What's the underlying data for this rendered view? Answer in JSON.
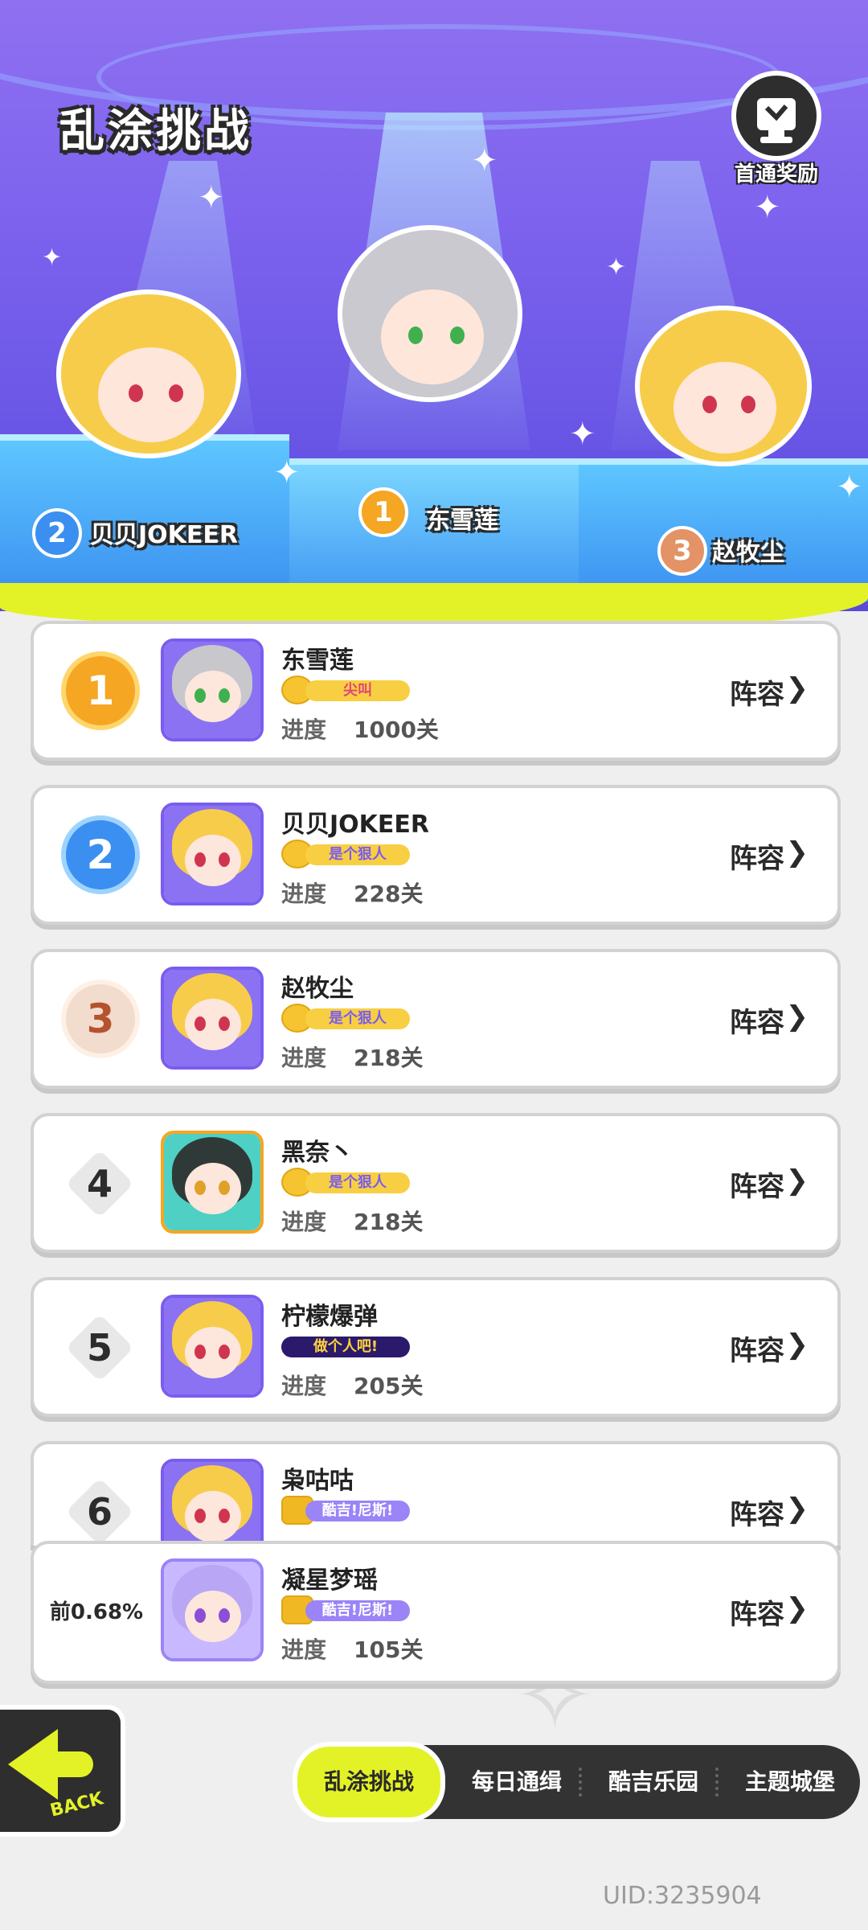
{
  "header": {
    "title": "乱涂挑战",
    "reward_button": {
      "label": "首通奖励",
      "icon": "trophy-icon"
    }
  },
  "podium": [
    {
      "rank": "2",
      "name": "贝贝JOKEER"
    },
    {
      "rank": "1",
      "name": "东雪莲"
    },
    {
      "rank": "3",
      "name": "赵牧尘"
    }
  ],
  "ranking": [
    {
      "rank": "1",
      "name": "东雪莲",
      "badge": "尖叫",
      "progress_label": "进度",
      "progress": "1000关",
      "lineup": "阵容"
    },
    {
      "rank": "2",
      "name": "贝贝JOKEER",
      "badge": "是个狠人",
      "progress_label": "进度",
      "progress": "228关",
      "lineup": "阵容"
    },
    {
      "rank": "3",
      "name": "赵牧尘",
      "badge": "是个狠人",
      "progress_label": "进度",
      "progress": "218关",
      "lineup": "阵容"
    },
    {
      "rank": "4",
      "name": "黑奈丶",
      "badge": "是个狠人",
      "progress_label": "进度",
      "progress": "218关",
      "lineup": "阵容"
    },
    {
      "rank": "5",
      "name": "柠檬爆弹",
      "badge": "做个人吧!",
      "progress_label": "进度",
      "progress": "205关",
      "lineup": "阵容"
    },
    {
      "rank": "6",
      "name": "枭咕咕",
      "badge": "酷吉!尼斯!",
      "lineup": "阵容"
    }
  ],
  "my_entry": {
    "rank": "前0.68%",
    "name": "凝星梦瑶",
    "badge": "酷吉!尼斯!",
    "progress_label": "进度",
    "progress": "105关",
    "lineup": "阵容"
  },
  "nav": {
    "back_label": "BACK",
    "tabs": [
      {
        "label": "乱涂挑战",
        "active": true
      },
      {
        "label": "每日通缉",
        "active": false
      },
      {
        "label": "酷吉乐园",
        "active": false
      },
      {
        "label": "主题城堡",
        "active": false
      }
    ]
  },
  "uid": "UID:3235904",
  "colors": {
    "accent": "#e3f226",
    "header_purple": "#7d63ee",
    "gold": "#f5a623",
    "blue": "#3a8ff0"
  }
}
